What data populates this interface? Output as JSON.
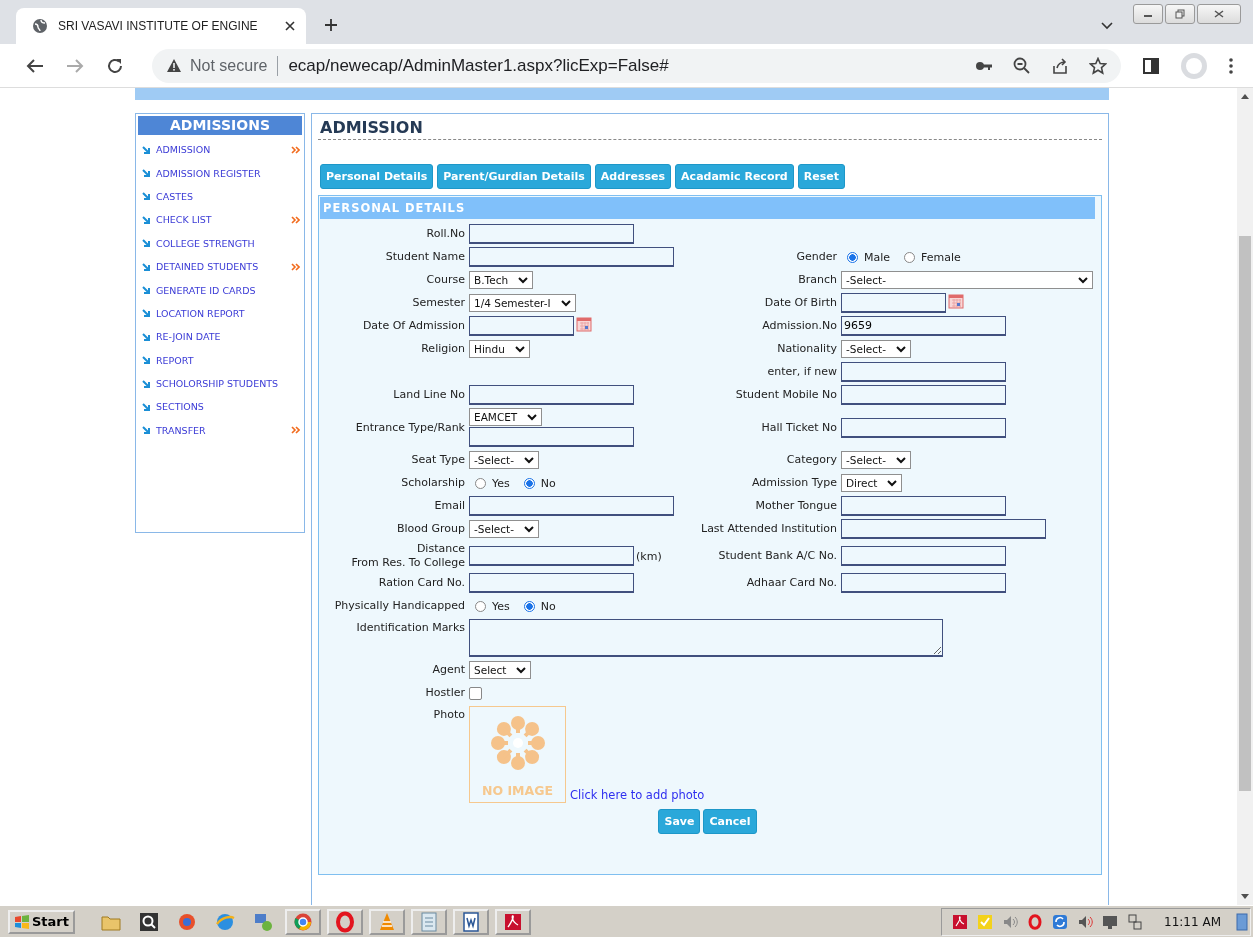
{
  "browser": {
    "tab_title": "SRI VASAVI INSTITUTE OF ENGINE",
    "security": "Not secure",
    "url": "ecap/newecap/AdminMaster1.aspx?licExp=False#"
  },
  "sidebar": {
    "title": "ADMISSIONS",
    "items": [
      {
        "label": "ADMISSION",
        "submenu": true
      },
      {
        "label": "ADMISSION REGISTER",
        "submenu": false
      },
      {
        "label": "CASTES",
        "submenu": false
      },
      {
        "label": "CHECK LIST",
        "submenu": true
      },
      {
        "label": "COLLEGE STRENGTH",
        "submenu": false
      },
      {
        "label": "DETAINED STUDENTS",
        "submenu": true
      },
      {
        "label": "GENERATE ID CARDS",
        "submenu": false
      },
      {
        "label": "LOCATION REPORT",
        "submenu": false
      },
      {
        "label": "RE-JOIN DATE",
        "submenu": false
      },
      {
        "label": "REPORT",
        "submenu": false
      },
      {
        "label": "SCHOLORSHIP STUDENTS",
        "submenu": false
      },
      {
        "label": "SECTIONS",
        "submenu": false
      },
      {
        "label": "TRANSFER",
        "submenu": true
      }
    ]
  },
  "main": {
    "title": "ADMISSION",
    "tabs": [
      "Personal Details",
      "Parent/Gurdian Details",
      "Addresses",
      "Acadamic Record",
      "Reset"
    ],
    "section_title": "PERSONAL DETAILS",
    "rows": [
      {
        "left": {
          "label": "Roll.No",
          "kind": "text"
        }
      },
      {
        "left": {
          "label": "Student Name",
          "kind": "long-text"
        },
        "right": {
          "label": "Gender",
          "kind": "radio",
          "options": [
            {
              "label": "Male",
              "selected": true
            },
            {
              "label": "Female",
              "selected": false
            }
          ]
        }
      },
      {
        "left": {
          "label": "Course",
          "kind": "select",
          "value": "B.Tech"
        },
        "right": {
          "label": "Branch",
          "kind": "wide-select",
          "value": "-Select-"
        }
      },
      {
        "left": {
          "label": "Semester",
          "kind": "select",
          "value": "1/4 Semester-I"
        },
        "right": {
          "label": "Date Of Birth",
          "kind": "date"
        }
      },
      {
        "left": {
          "label": "Date Of Admission",
          "kind": "date"
        },
        "right": {
          "label": "Admission.No",
          "kind": "text",
          "value": "9659"
        }
      },
      {
        "left": {
          "label": "Religion",
          "kind": "select",
          "value": "Hindu"
        },
        "right": {
          "label": "Nationality",
          "kind": "select",
          "value": "-Select-"
        }
      },
      {
        "right": {
          "label": "enter, if new",
          "kind": "text"
        }
      },
      {
        "left": {
          "label": "Land Line No",
          "kind": "text"
        },
        "right": {
          "label": "Student Mobile No",
          "kind": "text"
        }
      },
      {
        "left": {
          "label": "Entrance Type/Rank",
          "kind": "select-text",
          "value": "EAMCET"
        },
        "right": {
          "label": "Hall Ticket No",
          "kind": "text"
        }
      },
      {
        "left": {
          "label": "Seat Type",
          "kind": "select",
          "value": "-Select-"
        },
        "right": {
          "label": "Category",
          "kind": "select",
          "value": "-Select-"
        }
      },
      {
        "left": {
          "label": "Scholarship",
          "kind": "radio",
          "options": [
            {
              "label": "Yes",
              "selected": false
            },
            {
              "label": "No",
              "selected": true
            }
          ]
        },
        "right": {
          "label": "Admission Type",
          "kind": "select",
          "value": "Direct"
        }
      },
      {
        "left": {
          "label": "Email",
          "kind": "long-text"
        },
        "right": {
          "label": "Mother Tongue",
          "kind": "text"
        }
      },
      {
        "left": {
          "label": "Blood Group",
          "kind": "select",
          "value": "-Select-"
        },
        "right": {
          "label": "Last Attended Institution",
          "kind": "long-text"
        }
      },
      {
        "left": {
          "label": "Distance\nFrom Res. To College",
          "kind": "text",
          "suffix": "(km)"
        },
        "right": {
          "label": "Student Bank A/C No.",
          "kind": "text"
        }
      },
      {
        "left": {
          "label": "Ration Card No.",
          "kind": "text"
        },
        "right": {
          "label": "Adhaar Card No.",
          "kind": "text"
        }
      },
      {
        "left": {
          "label": "Physically Handicapped",
          "kind": "radio",
          "options": [
            {
              "label": "Yes",
              "selected": false
            },
            {
              "label": "No",
              "selected": true
            }
          ]
        }
      },
      {
        "left": {
          "label": "Identification Marks",
          "kind": "textarea"
        }
      },
      {
        "left": {
          "label": "Agent",
          "kind": "select",
          "value": "Select"
        }
      },
      {
        "left": {
          "label": "Hostler",
          "kind": "checkbox",
          "checked": false
        }
      },
      {
        "left": {
          "label": "Photo",
          "kind": "photo",
          "caption": "NO IMAGE",
          "link": "Click here to add photo"
        }
      }
    ],
    "actions": [
      "Save",
      "Cancel"
    ]
  },
  "taskbar": {
    "start": "Start",
    "clock": "11:11 AM"
  }
}
